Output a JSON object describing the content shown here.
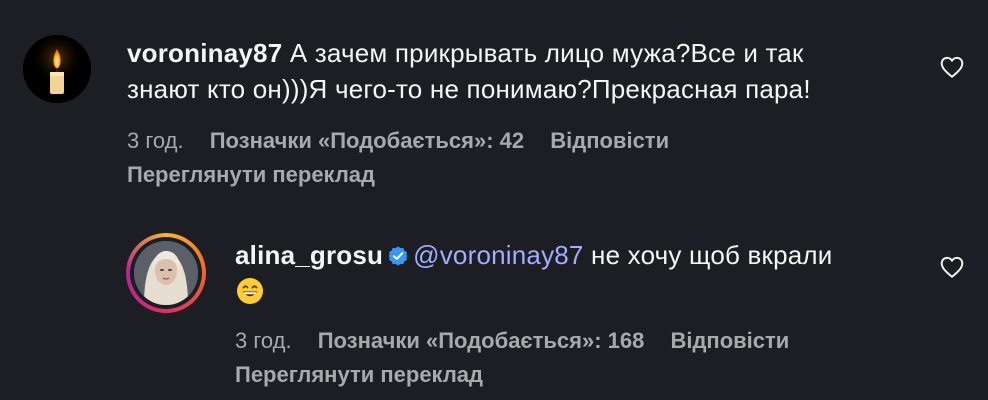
{
  "comments": [
    {
      "username": "voroninay87",
      "text_line1": "А зачем прикрывать лицо мужа?Все и так",
      "text_line2": "знают кто он)))Я чего-то не понимаю?Прекрасная пара!",
      "time": "3 год.",
      "likes": "Позначки «Подобається»: 42",
      "reply": "Відповісти",
      "translate": "Переглянути переклад",
      "avatar_icon": "candle-icon"
    },
    {
      "username": "alina_grosu",
      "verified": true,
      "mention": "@voroninay87",
      "text": "не хочу щоб вкрали",
      "emoji": "grinning-face-icon",
      "time": "3 год.",
      "likes": "Позначки «Подобається»: 168",
      "reply": "Відповісти",
      "translate": "Переглянути переклад"
    }
  ],
  "colors": {
    "background": "#1c1e23",
    "text": "#f5f5f5",
    "meta": "#a8a8ad",
    "mention": "#a1adff",
    "verified": "#3897f0"
  }
}
